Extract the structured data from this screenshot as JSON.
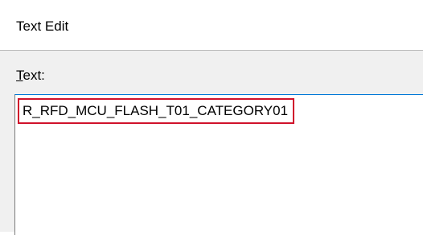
{
  "window": {
    "title": "Text Edit"
  },
  "form": {
    "label_accel": "T",
    "label_rest": "ext:",
    "text_value": "R_RFD_MCU_FLASH_T01_CATEGORY01"
  },
  "colors": {
    "highlight_border": "#d0112b",
    "focus_border": "#0078d7",
    "dialog_background": "#f0f0f0"
  }
}
